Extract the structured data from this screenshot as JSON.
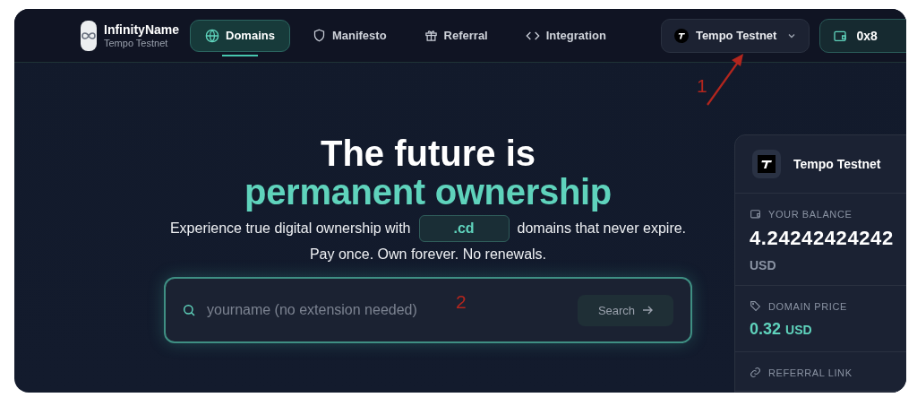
{
  "brand": {
    "name": "InfinityName",
    "subtitle": "Tempo Testnet"
  },
  "nav": [
    {
      "label": "Domains",
      "kind": "globe",
      "selected": true
    },
    {
      "label": "Manifesto",
      "kind": "shield",
      "selected": false
    },
    {
      "label": "Referral",
      "kind": "gift",
      "selected": false
    },
    {
      "label": "Integration",
      "kind": "code",
      "selected": false
    }
  ],
  "network_selector": {
    "label": "Tempo Testnet"
  },
  "wallet_button": {
    "label": "0x8"
  },
  "hero": {
    "title": "The future is",
    "highlight": "permanent ownership",
    "subtitle_before": "Experience true digital ownership with",
    "extension": ".cd",
    "subtitle_after": "domains that never expire.",
    "tagline": "Pay once. Own forever. No renewals."
  },
  "search": {
    "placeholder": "yourname (no extension needed)",
    "button": "Search"
  },
  "panel": {
    "network": "Tempo Testnet",
    "sections": [
      {
        "kind": "balance",
        "label": "YOUR BALANCE",
        "value": "4.24242424242",
        "unit": "USD"
      },
      {
        "kind": "price",
        "label": "DOMAIN PRICE",
        "value": "0.32",
        "unit": "USD"
      },
      {
        "kind": "link",
        "label": "REFERRAL LINK"
      }
    ]
  },
  "annotations": [
    {
      "kind": "arrow",
      "label": "1"
    },
    {
      "kind": "number",
      "label": "2"
    }
  ]
}
